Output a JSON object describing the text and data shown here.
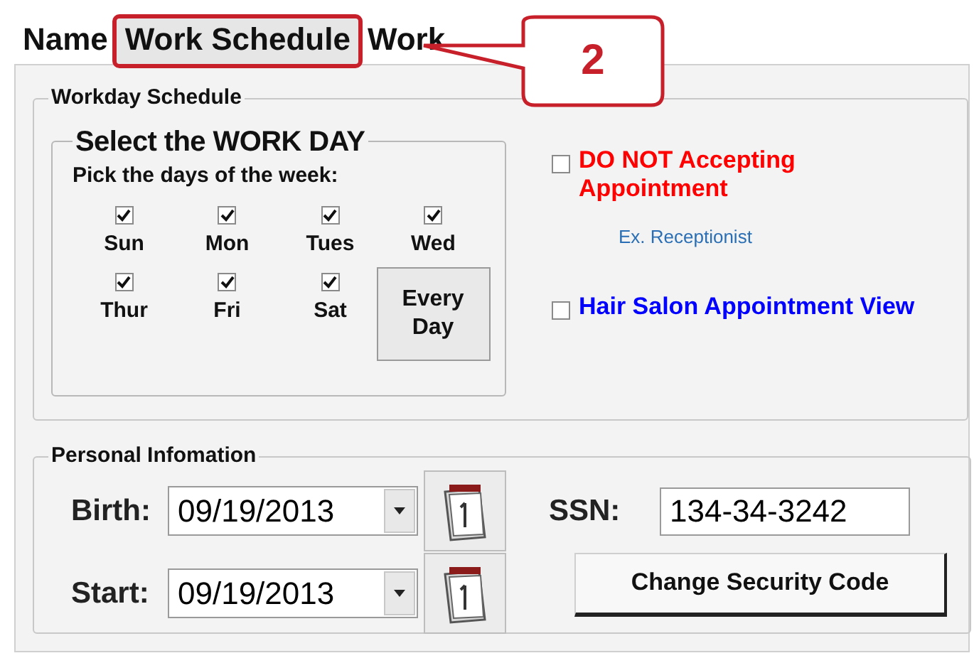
{
  "tabs": [
    {
      "label": "Name",
      "selected": false,
      "highlighted": false
    },
    {
      "label": "Work Schedule",
      "selected": true,
      "highlighted": true
    },
    {
      "label": "Work",
      "selected": false,
      "highlighted": false
    }
  ],
  "callout": {
    "label": "2"
  },
  "workday_schedule": {
    "title": "Workday Schedule",
    "select_group": {
      "title": "Select the WORK DAY",
      "prompt": "Pick the days of the week:",
      "days": [
        {
          "label": "Sun",
          "checked": true
        },
        {
          "label": "Mon",
          "checked": true
        },
        {
          "label": "Tues",
          "checked": true
        },
        {
          "label": "Wed",
          "checked": true
        },
        {
          "label": "Thur",
          "checked": true
        },
        {
          "label": "Fri",
          "checked": true
        },
        {
          "label": "Sat",
          "checked": true
        }
      ],
      "every_day_button": "Every Day"
    },
    "options": [
      {
        "label": "DO NOT Accepting Appointment",
        "checked": false,
        "color": "#ff0000",
        "note": "Ex. Receptionist"
      },
      {
        "label": "Hair Salon Appointment View",
        "checked": false,
        "color": "#0000ff"
      }
    ]
  },
  "personal_information": {
    "title": "Personal Infomation",
    "dates": [
      {
        "label": "Birth:",
        "value": "09/19/2013"
      },
      {
        "label": "Start:",
        "value": "09/19/2013"
      }
    ],
    "ssn": {
      "label": "SSN:",
      "value": "134-34-3242"
    },
    "change_button": "Change Security Code"
  }
}
